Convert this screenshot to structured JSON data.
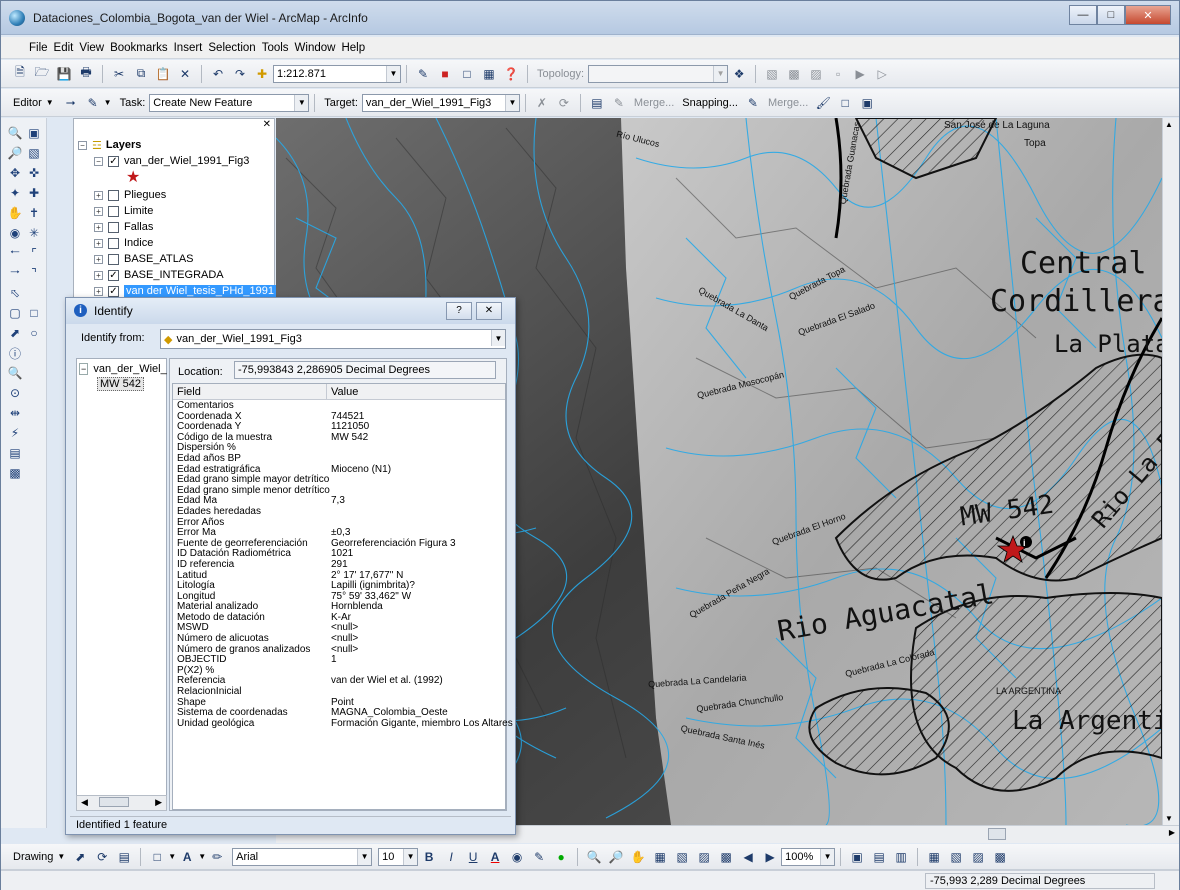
{
  "window": {
    "title": "Dataciones_Colombia_Bogota_van der Wiel - ArcMap - ArcInfo"
  },
  "menu": [
    "File",
    "Edit",
    "View",
    "Bookmarks",
    "Insert",
    "Selection",
    "Tools",
    "Window",
    "Help"
  ],
  "standard_toolbar": {
    "scale": "1:212.871",
    "topology_label": "Topology:"
  },
  "editor_toolbar": {
    "editor_label": "Editor",
    "task_label": "Task:",
    "task_value": "Create New Feature",
    "target_label": "Target:",
    "target_value": "van_der_Wiel_1991_Fig3",
    "merge_label": "Merge...",
    "snapping_label": "Snapping...",
    "merge2_label": "Merge..."
  },
  "toc": {
    "root": "Layers",
    "layers": [
      {
        "name": "van_der_Wiel_1991_Fig3",
        "checked": true,
        "expanded": true
      },
      {
        "name": "Pliegues",
        "checked": false
      },
      {
        "name": "Limite",
        "checked": false
      },
      {
        "name": "Fallas",
        "checked": false
      },
      {
        "name": "Indice",
        "checked": false
      },
      {
        "name": "BASE_ATLAS",
        "checked": false
      },
      {
        "name": "BASE_INTEGRADA",
        "checked": true
      },
      {
        "name": "van der Wiel_tesis_PHd_1991",
        "checked": true,
        "selected": true
      }
    ]
  },
  "map": {
    "labels": {
      "central": "Central",
      "cordillera": "Cordillera",
      "laplata": "La Plata",
      "mw542": "MW 542",
      "rioaguacatal": "Rio Aguacatal",
      "laargentina": "La Argentina",
      "riolaplata": "Rio La Plata",
      "sanjose": "San José de La Laguna",
      "topa": "Topa",
      "q_mosocopan": "Quebrada Mosocopán",
      "q_elsalado": "Quebrada El Salado",
      "q_ladanta": "Quebrada La Danta",
      "q_topa": "Quebrada Topa",
      "q_chunchullo": "Quebrada Chunchullo",
      "q_candelaria": "Quebrada La Candelaria",
      "q_santaines": "Quebrada Santa Inés",
      "q_lacolorada": "Quebrada La Colorada",
      "q_guanacas": "Quebrada Guanacas",
      "q_ulucos": "Río Ulucos",
      "argentina_small": "LA ARGENTINA",
      "q_elhorno": "Quebrada El Horno",
      "q_penanegra": "Quebrada Peña Negra"
    }
  },
  "identify": {
    "title": "Identify",
    "identify_from_label": "Identify from:",
    "identify_from_value": "van_der_Wiel_1991_Fig3",
    "tree_root": "van_der_Wiel_",
    "tree_child": "MW 542",
    "location_label": "Location:",
    "location_value": "-75,993843  2,286905 Decimal Degrees",
    "field_header": "Field",
    "value_header": "Value",
    "rows": [
      {
        "f": "Comentarios",
        "v": ""
      },
      {
        "f": "Coordenada X",
        "v": "744521"
      },
      {
        "f": "Coordenada Y",
        "v": "1121050"
      },
      {
        "f": "Código de la muestra",
        "v": "MW 542"
      },
      {
        "f": "Dispersión %",
        "v": ""
      },
      {
        "f": "Edad años BP",
        "v": ""
      },
      {
        "f": "Edad estratigráfica",
        "v": "Mioceno (N1)"
      },
      {
        "f": "Edad grano simple mayor detrítico",
        "v": ""
      },
      {
        "f": "Edad grano simple menor detrítico",
        "v": ""
      },
      {
        "f": "Edad Ma",
        "v": "7,3"
      },
      {
        "f": "Edades heredadas",
        "v": ""
      },
      {
        "f": "Error Años",
        "v": ""
      },
      {
        "f": "Error Ma",
        "v": "±0,3"
      },
      {
        "f": "Fuente de georreferenciación",
        "v": "Georreferenciación Figura 3"
      },
      {
        "f": "ID Datación Radiométrica",
        "v": "1021"
      },
      {
        "f": "ID referencia",
        "v": "291"
      },
      {
        "f": "Latitud",
        "v": "2° 17' 17,677\" N"
      },
      {
        "f": "Litología",
        "v": "Lapilli (ignimbrita)?"
      },
      {
        "f": "Longitud",
        "v": "75° 59' 33,462\" W"
      },
      {
        "f": "Material analizado",
        "v": "Hornblenda"
      },
      {
        "f": "Metodo de datación",
        "v": "K-Ar"
      },
      {
        "f": "MSWD",
        "v": "<null>"
      },
      {
        "f": "Número de alicuotas",
        "v": "<null>"
      },
      {
        "f": "Número de granos analizados",
        "v": "<null>"
      },
      {
        "f": "OBJECTID",
        "v": "1"
      },
      {
        "f": "P(X2) %",
        "v": ""
      },
      {
        "f": "Referencia",
        "v": "van der Wiel et al. (1992)"
      },
      {
        "f": "RelacionInicial",
        "v": ""
      },
      {
        "f": "Shape",
        "v": "Point"
      },
      {
        "f": "Sistema de coordenadas",
        "v": "MAGNA_Colombia_Oeste"
      },
      {
        "f": "Unidad geológica",
        "v": "Formación Gigante, miembro Los Altares"
      }
    ],
    "status": "Identified 1 feature"
  },
  "drawing_toolbar": {
    "drawing_label": "Drawing",
    "font": "Arial",
    "size": "10",
    "zoom": "100%"
  },
  "status": {
    "coords": "-75,993  2,289 Decimal Degrees"
  }
}
